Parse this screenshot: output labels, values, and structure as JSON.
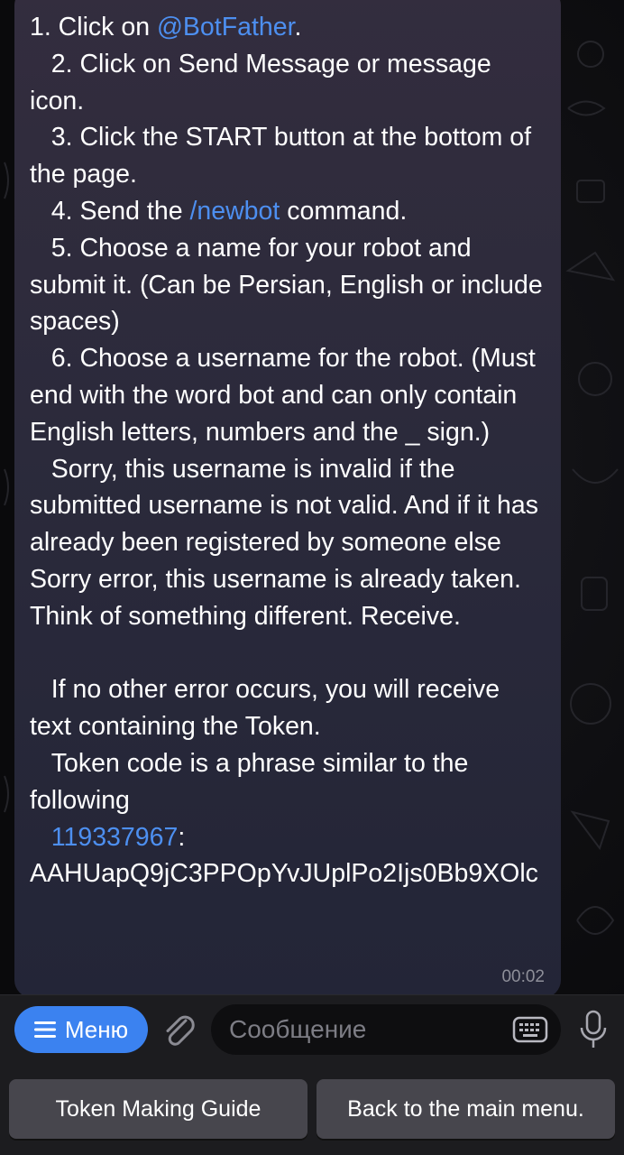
{
  "message": {
    "line1_prefix": "1. Click on ",
    "line1_link": "@BotFather",
    "line1_suffix": ".",
    "step2": "   2. Click on Send Message or message icon.",
    "step3": "   3. Click the START button at the bottom of the page.",
    "step4_prefix": "   4. Send the ",
    "step4_link": "/newbot",
    "step4_suffix": " command.",
    "step5": "   5. Choose a name for your robot and submit it. (Can be Persian, English or include spaces)",
    "step6": "   6. Choose a username for the robot. (Must end with the word bot and can only contain English letters, numbers and the _ sign.)",
    "sorry": "   Sorry, this username is invalid if the submitted username is not valid. And if it has already been registered by someone else Sorry error, this username is already taken. Think of something different. Receive.",
    "no_error": "   If no other error occurs, you will receive text containing the Token.",
    "token_intro": "   Token code is a phrase similar to the following",
    "token_id": "119337967",
    "token_colon": ":",
    "token_secret": "AAHUapQ9jC3PPOpYvJUplPo2Ijs0Bb9XOlc",
    "time": "00:02"
  },
  "input_bar": {
    "menu_label": "Меню",
    "message_placeholder": "Сообщение"
  },
  "reply_keyboard": {
    "left_button": "Token Making Guide",
    "right_button": "Back to the main menu."
  },
  "colors": {
    "link": "#4d8ff0",
    "menu_button": "#3b82f0",
    "keyboard_button": "#47464d"
  },
  "icons": [
    "hamburger-icon",
    "paperclip-icon",
    "keyboard-icon",
    "microphone-icon"
  ]
}
